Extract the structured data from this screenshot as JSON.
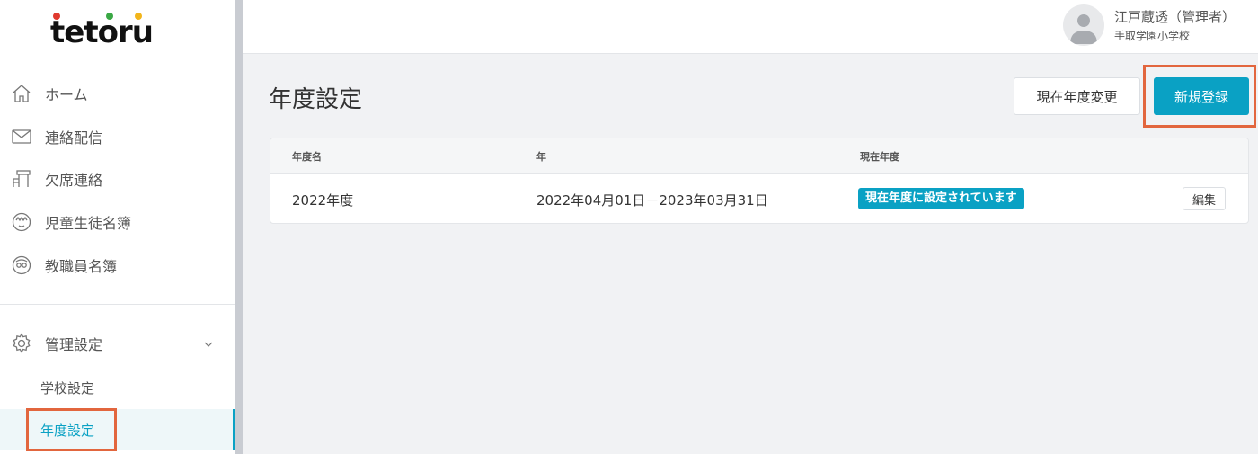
{
  "logo": {
    "text": "tetoru",
    "dot_colors": [
      "#e03a2f",
      "#3aa845",
      "#f2b51b"
    ]
  },
  "sidebar": {
    "items": [
      {
        "label": "ホーム",
        "icon": "home-icon"
      },
      {
        "label": "連絡配信",
        "icon": "mail-icon"
      },
      {
        "label": "欠席連絡",
        "icon": "desk-chair-icon"
      },
      {
        "label": "児童生徒名簿",
        "icon": "child-face-icon"
      },
      {
        "label": "教職員名簿",
        "icon": "teacher-face-icon"
      }
    ],
    "admin": {
      "label": "管理設定",
      "icon": "gear-icon",
      "sub_items": [
        {
          "label": "学校設定"
        },
        {
          "label": "年度設定",
          "active": true
        }
      ]
    }
  },
  "header": {
    "user_name": "江戸蔵透（管理者）",
    "school_name": "手取学園小学校",
    "avatar_icon": "user-avatar-icon"
  },
  "main": {
    "title": "年度設定",
    "change_button": "現在年度変更",
    "new_button": "新規登録",
    "table": {
      "columns": [
        "年度名",
        "年",
        "現在年度"
      ],
      "rows": [
        {
          "name": "2022年度",
          "period": "2022年04月01日－2023年03月31日",
          "badge": "現在年度に設定されています",
          "edit": "編集"
        }
      ]
    }
  },
  "colors": {
    "accent": "#0aa1c4",
    "highlight": "#e2663e"
  }
}
